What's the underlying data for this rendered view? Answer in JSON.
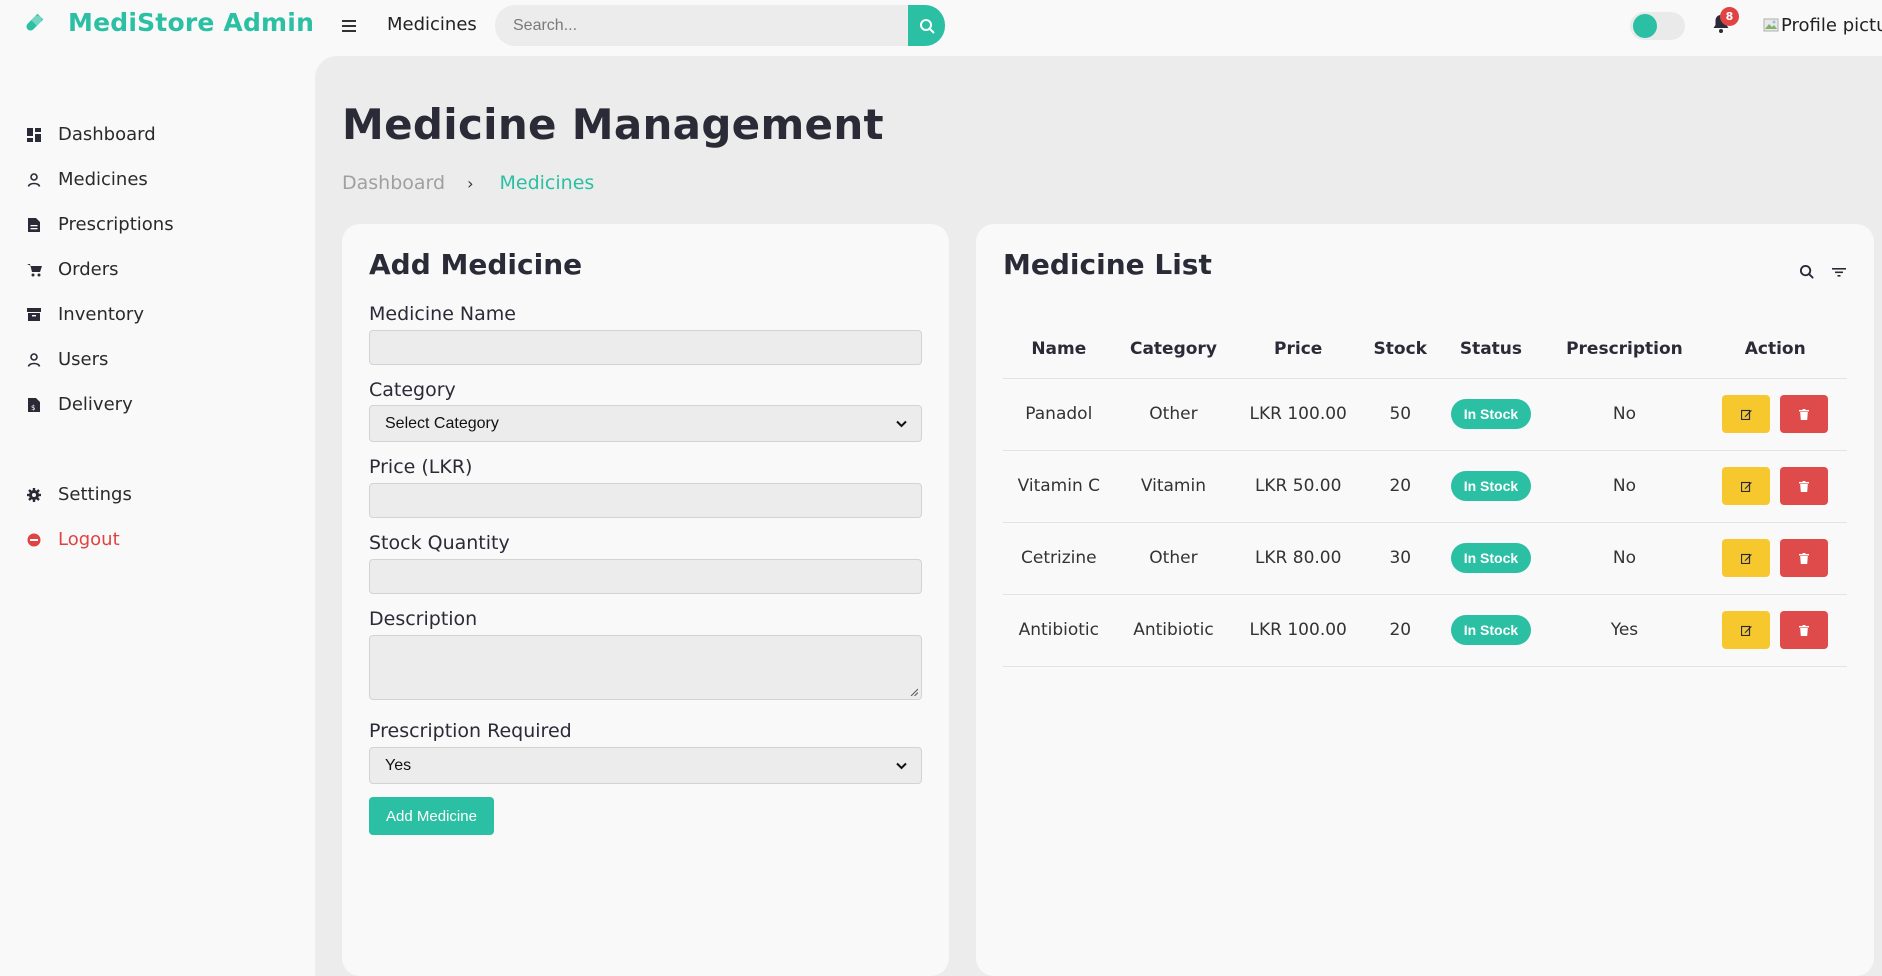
{
  "brand": {
    "name": "MediStore Admin",
    "accent": "#2bbfa4"
  },
  "topbar": {
    "page_label": "Medicines",
    "search_placeholder": "Search...",
    "notification_count": "8",
    "profile_alt": "Profile picture"
  },
  "sidebar": {
    "items": [
      {
        "label": "Dashboard",
        "icon": "dashboard-grid-icon"
      },
      {
        "label": "Medicines",
        "icon": "user-icon"
      },
      {
        "label": "Prescriptions",
        "icon": "file-icon"
      },
      {
        "label": "Orders",
        "icon": "cart-icon"
      },
      {
        "label": "Inventory",
        "icon": "archive-box-icon"
      },
      {
        "label": "Users",
        "icon": "user-icon"
      },
      {
        "label": "Delivery",
        "icon": "invoice-icon"
      }
    ],
    "settings": {
      "label": "Settings",
      "icon": "gear-icon"
    },
    "logout": {
      "label": "Logout",
      "icon": "logout-icon",
      "color": "#e04343"
    }
  },
  "page": {
    "title": "Medicine Management",
    "breadcrumb": [
      "Dashboard",
      "Medicines"
    ]
  },
  "add_form": {
    "title": "Add Medicine",
    "name_label": "Medicine Name",
    "name_value": "",
    "category_label": "Category",
    "category_selected": "Select Category",
    "price_label": "Price (LKR)",
    "price_value": "",
    "stock_label": "Stock Quantity",
    "stock_value": "",
    "description_label": "Description",
    "description_value": "",
    "prescription_label": "Prescription Required",
    "prescription_selected": "Yes",
    "submit_label": "Add Medicine"
  },
  "medicine_list": {
    "title": "Medicine List",
    "columns": [
      "Name",
      "Category",
      "Price",
      "Stock",
      "Status",
      "Prescription",
      "Action"
    ],
    "rows": [
      {
        "name": "Panadol",
        "category": "Other",
        "price": "LKR 100.00",
        "stock": "50",
        "status": "In Stock",
        "prescription": "No"
      },
      {
        "name": "Vitamin C",
        "category": "Vitamin",
        "price": "LKR 50.00",
        "stock": "20",
        "status": "In Stock",
        "prescription": "No"
      },
      {
        "name": "Cetrizine",
        "category": "Other",
        "price": "LKR 80.00",
        "stock": "30",
        "status": "In Stock",
        "prescription": "No"
      },
      {
        "name": "Antibiotic",
        "category": "Antibiotic",
        "price": "LKR 100.00",
        "stock": "20",
        "status": "In Stock",
        "prescription": "Yes"
      }
    ],
    "colors": {
      "status": "#2bbfa4",
      "edit": "#f7c82e",
      "delete": "#df4a4a"
    }
  }
}
